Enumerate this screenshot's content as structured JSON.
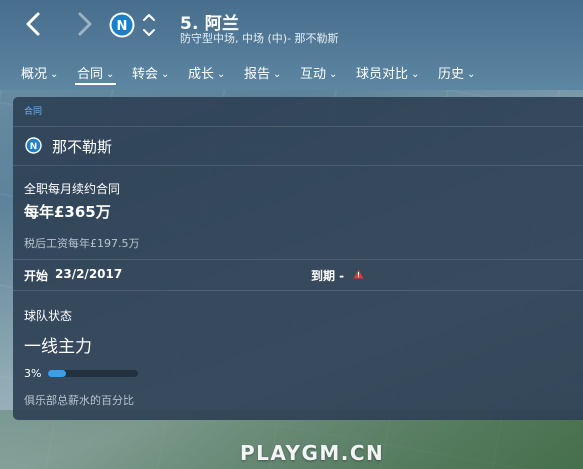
{
  "header": {
    "player_name": "5. 阿兰",
    "player_subtitle": "防守型中场, 中场 (中)- 那不勒斯"
  },
  "tabs": [
    {
      "label": "概况"
    },
    {
      "label": "合同"
    },
    {
      "label": "转会"
    },
    {
      "label": "成长"
    },
    {
      "label": "报告"
    },
    {
      "label": "互动"
    },
    {
      "label": "球员对比"
    },
    {
      "label": "历史"
    }
  ],
  "active_tab": "合同",
  "panel": {
    "title": "合同",
    "club_name": "那不勒斯",
    "contract_type": "全职每月续约合同",
    "wage": "每年£365万",
    "after_tax": "税后工资每年£197.5万",
    "start_label": "开始",
    "start_date": "23/2/2017",
    "expiry_label": "到期 -",
    "squad_status_label": "球队状态",
    "squad_status": "一线主力",
    "wage_share_text": "3%",
    "wage_share_fraction": 0.03,
    "wage_share_caption": "俱乐部总薪水的百分比"
  },
  "colors": {
    "accent_blue": "#3a9fe6",
    "panel_bg": "#2f4256",
    "warning_red": "#e0393b",
    "club_blue": "#1c7fc9"
  },
  "watermark": "PLAYGM.CN"
}
